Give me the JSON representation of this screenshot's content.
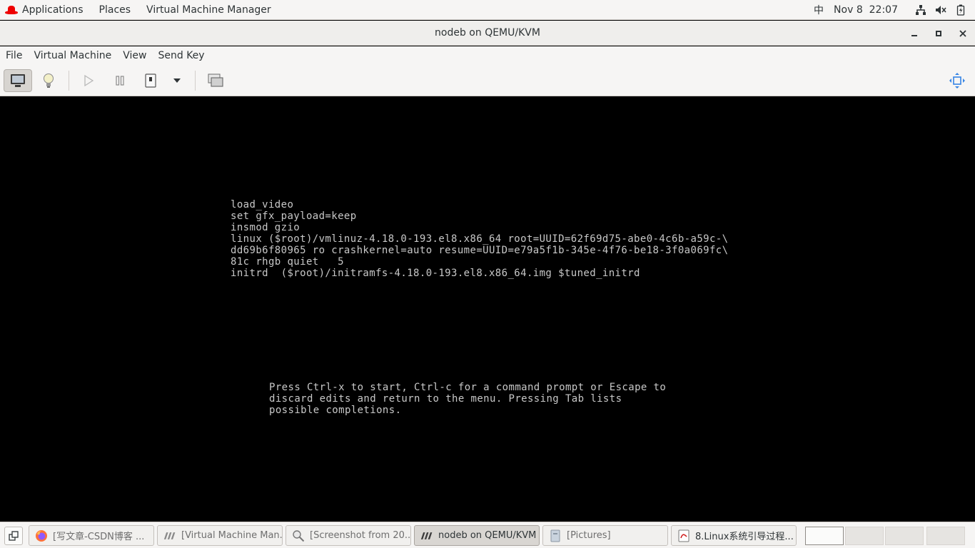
{
  "topbar": {
    "applications": "Applications",
    "places": "Places",
    "app_name": "Virtual Machine Manager",
    "ime": "中",
    "date": "Nov 8",
    "time": "22:07",
    "tray_icons": [
      "network-icon",
      "volume-icon",
      "battery-icon"
    ]
  },
  "window": {
    "title": "nodeb on QEMU/KVM",
    "controls": [
      "minimize-icon",
      "maximize-icon",
      "close-icon"
    ]
  },
  "menubar": {
    "items": [
      "File",
      "Virtual Machine",
      "View",
      "Send Key"
    ]
  },
  "toolbar": {
    "buttons": [
      "console-icon",
      "details-bulb-icon",
      "run-icon",
      "pause-icon",
      "shutdown-icon",
      "shutdown-menu-icon",
      "snapshots-icon",
      "fullscreen-icon"
    ]
  },
  "console": {
    "lines": [
      "load_video",
      "set gfx_payload=keep",
      "insmod gzio",
      "linux ($root)/vmlinuz-4.18.0-193.el8.x86_64 root=UUID=62f69d75-abe0-4c6b-a59c-\\",
      "dd69b6f80965 ro crashkernel=auto resume=UUID=e79a5f1b-345e-4f76-be18-3f0a069fc\\",
      "81c rhgb quiet   5",
      "initrd  ($root)/initramfs-4.18.0-193.el8.x86_64.img $tuned_initrd"
    ],
    "help": [
      "Press Ctrl-x to start, Ctrl-c for a command prompt or Escape to",
      "discard edits and return to the menu. Pressing Tab lists",
      "possible completions."
    ]
  },
  "taskbar": {
    "tasks": [
      {
        "label": "[写文章-CSDN博客 ...",
        "icon": "firefox-icon"
      },
      {
        "label": "[Virtual Machine Man...",
        "icon": "virt-manager-icon"
      },
      {
        "label": "[Screenshot from 20...",
        "icon": "screenshot-icon"
      },
      {
        "label": "nodeb on QEMU/KVM",
        "icon": "virt-manager-icon"
      },
      {
        "label": "[Pictures]",
        "icon": "folder-icon"
      },
      {
        "label": "8.Linux系统引导过程...",
        "icon": "document-viewer-icon"
      }
    ],
    "workspaces": 4,
    "active_workspace": 1
  },
  "colors": {
    "console_bg": "#000000",
    "console_text": "#c8c8c8",
    "chrome_bg": "#f6f5f4",
    "redhat_red": "#ee0000",
    "focus_blue": "#3584e4"
  }
}
